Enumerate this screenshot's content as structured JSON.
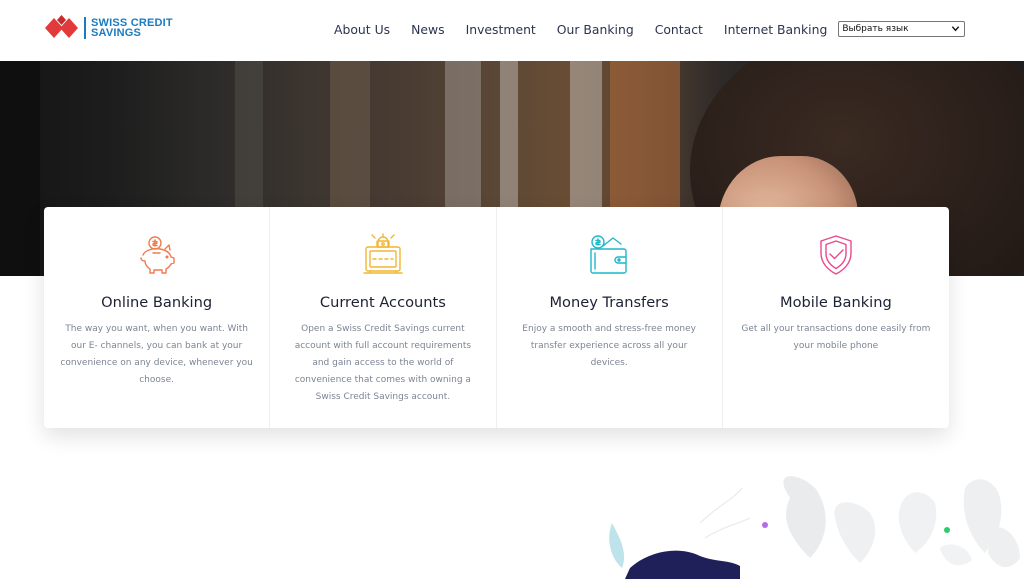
{
  "brand": {
    "line1": "SWISS CREDIT",
    "line2": "SAVINGS",
    "colors": {
      "red": "#e23a3a",
      "blue": "#1a7bbf"
    }
  },
  "nav": {
    "items": [
      "About Us",
      "News",
      "Investment",
      "Our Banking",
      "Contact",
      "Internet Banking"
    ],
    "language_select": "Выбрать язык"
  },
  "cards": [
    {
      "icon": "piggy-bank-icon",
      "title": "Online Banking",
      "text": "The way you want, when you want. With our E- channels, you can bank at your convenience on any device, whenever you choose."
    },
    {
      "icon": "safe-lock-icon",
      "title": "Current Accounts",
      "text": "Open a Swiss Credit Savings current account with full account requirements and gain access to the world of convenience that comes with owning a Swiss Credit Savings account."
    },
    {
      "icon": "wallet-money-icon",
      "title": "Money Transfers",
      "text": "Enjoy a smooth and stress-free money transfer experience across all your devices."
    },
    {
      "icon": "shield-check-icon",
      "title": "Mobile Banking",
      "text": "Get all your transactions done easily from your mobile phone"
    }
  ],
  "icon_colors": {
    "piggy": "#ef7b4e",
    "safe": "#f2b632",
    "wallet": "#1fb7c9",
    "shield": "#e84a8a"
  }
}
